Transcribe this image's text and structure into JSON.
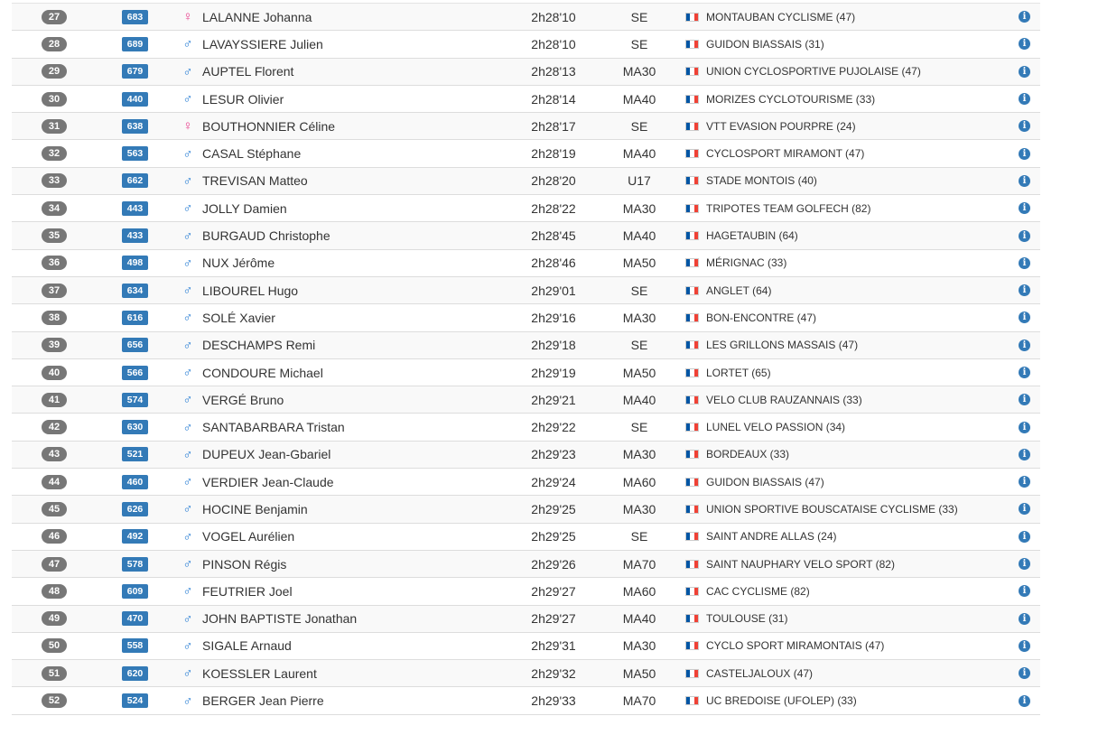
{
  "colors": {
    "rank_badge": "#777777",
    "bib_badge": "#337ab7",
    "female": "#e83e8c",
    "male": "#2a7fd4",
    "info": "#337ab7",
    "flag_blue": "#0055a4",
    "flag_white": "#ffffff",
    "flag_red": "#ef4135"
  },
  "icons": {
    "female": "♀",
    "male": "♂",
    "info": "i",
    "flag": "france-flag-icon"
  },
  "rows": [
    {
      "rank": "27",
      "bib": "683",
      "sex": "F",
      "name": "LALANNE Johanna",
      "time": "2h28'10",
      "cat": "SE",
      "club": "MONTAUBAN CYCLISME (47)"
    },
    {
      "rank": "28",
      "bib": "689",
      "sex": "M",
      "name": "LAVAYSSIERE Julien",
      "time": "2h28'10",
      "cat": "SE",
      "club": "GUIDON BIASSAIS (31)"
    },
    {
      "rank": "29",
      "bib": "679",
      "sex": "M",
      "name": "AUPTEL Florent",
      "time": "2h28'13",
      "cat": "MA30",
      "club": "UNION CYCLOSPORTIVE PUJOLAISE (47)"
    },
    {
      "rank": "30",
      "bib": "440",
      "sex": "M",
      "name": "LESUR Olivier",
      "time": "2h28'14",
      "cat": "MA40",
      "club": "MORIZES CYCLOTOURISME (33)"
    },
    {
      "rank": "31",
      "bib": "638",
      "sex": "F",
      "name": "BOUTHONNIER Céline",
      "time": "2h28'17",
      "cat": "SE",
      "club": "VTT EVASION POURPRE (24)"
    },
    {
      "rank": "32",
      "bib": "563",
      "sex": "M",
      "name": "CASAL Stéphane",
      "time": "2h28'19",
      "cat": "MA40",
      "club": "CYCLOSPORT MIRAMONT (47)"
    },
    {
      "rank": "33",
      "bib": "662",
      "sex": "M",
      "name": "TREVISAN Matteo",
      "time": "2h28'20",
      "cat": "U17",
      "club": "STADE MONTOIS (40)"
    },
    {
      "rank": "34",
      "bib": "443",
      "sex": "M",
      "name": "JOLLY Damien",
      "time": "2h28'22",
      "cat": "MA30",
      "club": "TRIPOTES TEAM GOLFECH (82)"
    },
    {
      "rank": "35",
      "bib": "433",
      "sex": "M",
      "name": "BURGAUD Christophe",
      "time": "2h28'45",
      "cat": "MA40",
      "club": "HAGETAUBIN (64)"
    },
    {
      "rank": "36",
      "bib": "498",
      "sex": "M",
      "name": "NUX Jérôme",
      "time": "2h28'46",
      "cat": "MA50",
      "club": "MÉRIGNAC (33)"
    },
    {
      "rank": "37",
      "bib": "634",
      "sex": "M",
      "name": "LIBOUREL Hugo",
      "time": "2h29'01",
      "cat": "SE",
      "club": "ANGLET (64)"
    },
    {
      "rank": "38",
      "bib": "616",
      "sex": "M",
      "name": "SOLÉ Xavier",
      "time": "2h29'16",
      "cat": "MA30",
      "club": "BON-ENCONTRE (47)"
    },
    {
      "rank": "39",
      "bib": "656",
      "sex": "M",
      "name": "DESCHAMPS Remi",
      "time": "2h29'18",
      "cat": "SE",
      "club": "LES GRILLONS MASSAIS (47)"
    },
    {
      "rank": "40",
      "bib": "566",
      "sex": "M",
      "name": "CONDOURE Michael",
      "time": "2h29'19",
      "cat": "MA50",
      "club": "LORTET (65)"
    },
    {
      "rank": "41",
      "bib": "574",
      "sex": "M",
      "name": "VERGÉ Bruno",
      "time": "2h29'21",
      "cat": "MA40",
      "club": "VELO CLUB RAUZANNAIS (33)"
    },
    {
      "rank": "42",
      "bib": "630",
      "sex": "M",
      "name": "SANTABARBARA Tristan",
      "time": "2h29'22",
      "cat": "SE",
      "club": "LUNEL VELO PASSION (34)"
    },
    {
      "rank": "43",
      "bib": "521",
      "sex": "M",
      "name": "DUPEUX Jean-Gbariel",
      "time": "2h29'23",
      "cat": "MA30",
      "club": "BORDEAUX (33)"
    },
    {
      "rank": "44",
      "bib": "460",
      "sex": "M",
      "name": "VERDIER Jean-Claude",
      "time": "2h29'24",
      "cat": "MA60",
      "club": "GUIDON BIASSAIS (47)"
    },
    {
      "rank": "45",
      "bib": "626",
      "sex": "M",
      "name": "HOCINE Benjamin",
      "time": "2h29'25",
      "cat": "MA30",
      "club": "UNION SPORTIVE BOUSCATAISE CYCLISME (33)"
    },
    {
      "rank": "46",
      "bib": "492",
      "sex": "M",
      "name": "VOGEL Aurélien",
      "time": "2h29'25",
      "cat": "SE",
      "club": "SAINT ANDRE ALLAS (24)"
    },
    {
      "rank": "47",
      "bib": "578",
      "sex": "M",
      "name": "PINSON Régis",
      "time": "2h29'26",
      "cat": "MA70",
      "club": "SAINT NAUPHARY VELO SPORT (82)"
    },
    {
      "rank": "48",
      "bib": "609",
      "sex": "M",
      "name": "FEUTRIER Joel",
      "time": "2h29'27",
      "cat": "MA60",
      "club": "CAC CYCLISME (82)"
    },
    {
      "rank": "49",
      "bib": "470",
      "sex": "M",
      "name": "JOHN BAPTISTE Jonathan",
      "time": "2h29'27",
      "cat": "MA40",
      "club": "TOULOUSE (31)"
    },
    {
      "rank": "50",
      "bib": "558",
      "sex": "M",
      "name": "SIGALE Arnaud",
      "time": "2h29'31",
      "cat": "MA30",
      "club": "CYCLO SPORT MIRAMONTAIS (47)"
    },
    {
      "rank": "51",
      "bib": "620",
      "sex": "M",
      "name": "KOESSLER Laurent",
      "time": "2h29'32",
      "cat": "MA50",
      "club": "CASTELJALOUX (47)"
    },
    {
      "rank": "52",
      "bib": "524",
      "sex": "M",
      "name": "BERGER Jean Pierre",
      "time": "2h29'33",
      "cat": "MA70",
      "club": "UC BREDOISE (UFOLEP) (33)"
    }
  ]
}
